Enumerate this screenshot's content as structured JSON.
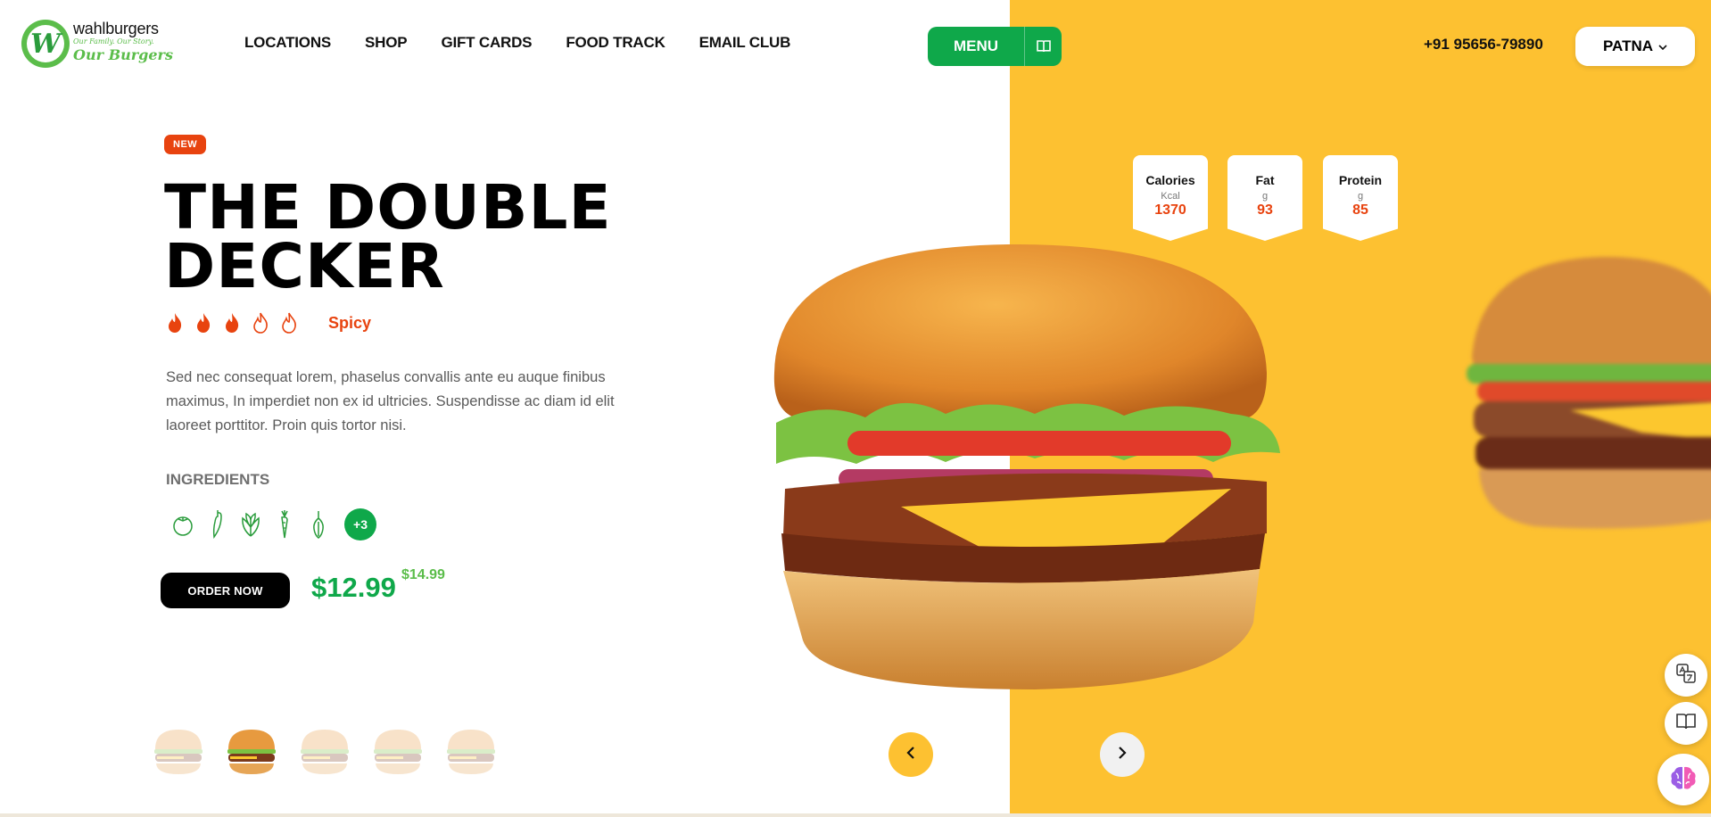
{
  "brand": {
    "name": "wahlburgers",
    "tagline_small": "Our Family. Our Story.",
    "tagline_large": "Our Burgers",
    "logo_letter": "W"
  },
  "nav": {
    "items": [
      {
        "label": "LOCATIONS"
      },
      {
        "label": "SHOP"
      },
      {
        "label": "GIFT CARDS"
      },
      {
        "label": "FOOD TRACK"
      },
      {
        "label": "EMAIL CLUB"
      }
    ]
  },
  "menu_button": {
    "label": "MENU",
    "icon": "book-icon"
  },
  "phone": "+91 95656-79890",
  "city_selector": {
    "value": "PATNA",
    "icon": "chevron-down-icon"
  },
  "product": {
    "badge": "NEW",
    "title": "THE DOUBLE DECKER",
    "spice": {
      "label": "Spicy",
      "level": 3,
      "max": 5
    },
    "description": "Sed nec consequat lorem, phaselus convallis ante eu auque finibus maximus, In imperdiet non ex id ultricies. Suspendisse ac diam id elit laoreet porttitor. Proin quis tortor nisi.",
    "ingredients_title": "INGREDIENTS",
    "ingredients": [
      {
        "icon": "tomato-icon"
      },
      {
        "icon": "chili-pepper-icon"
      },
      {
        "icon": "lettuce-icon"
      },
      {
        "icon": "carrot-icon"
      },
      {
        "icon": "onion-icon"
      }
    ],
    "ingredients_more": "+3",
    "order_label": "ORDER NOW",
    "price": "$12.99",
    "old_price": "$14.99"
  },
  "nutrition": [
    {
      "label": "Calories",
      "unit": "Kcal",
      "value": "1370"
    },
    {
      "label": "Fat",
      "unit": "g",
      "value": "93"
    },
    {
      "label": "Protein",
      "unit": "g",
      "value": "85"
    }
  ],
  "carousel": {
    "thumb_count": 5,
    "active_index": 1,
    "prev_icon": "chevron-left-icon",
    "next_icon": "chevron-right-icon"
  },
  "floating_tools": [
    {
      "icon": "translate-icon"
    },
    {
      "icon": "reader-book-icon"
    },
    {
      "icon": "ai-brain-icon"
    }
  ],
  "colors": {
    "green": "#0fa84a",
    "light_green": "#5bbd4a",
    "orange_red": "#e8430f",
    "yellow": "#fdc131",
    "black": "#000000"
  }
}
